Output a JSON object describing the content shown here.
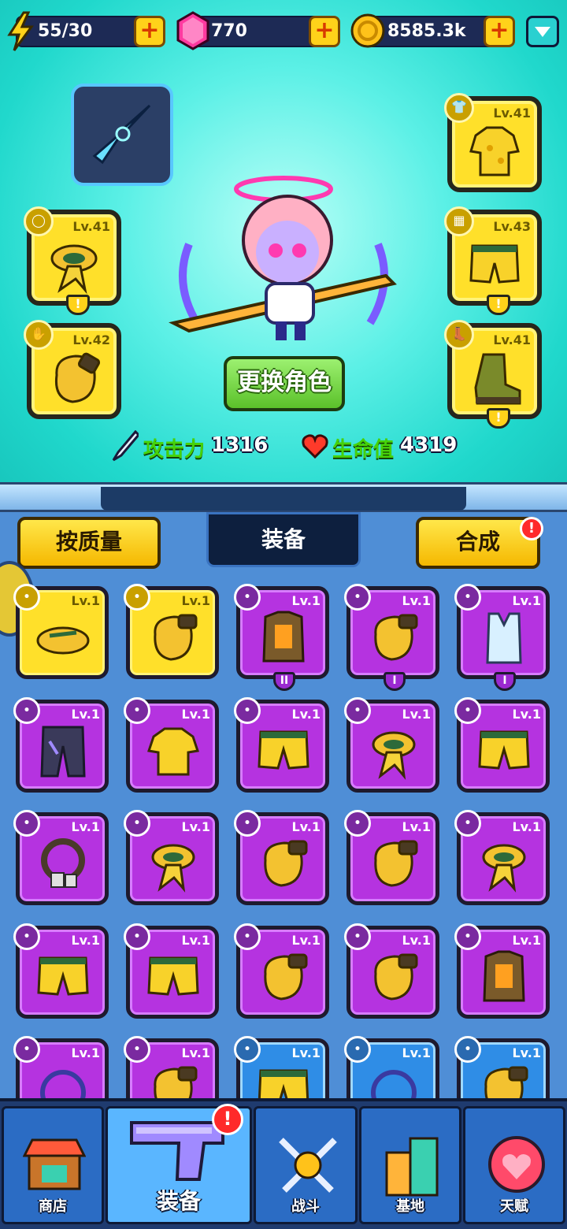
{
  "resources": {
    "energy": "55/30",
    "gems": "770",
    "coins": "8585.3k"
  },
  "equipped": {
    "left": [
      {
        "name": "scarf",
        "level": "Lv.41",
        "has_alert": true
      },
      {
        "name": "glove",
        "level": "Lv.42",
        "has_alert": false
      }
    ],
    "right": [
      {
        "name": "shirt",
        "level": "Lv.41",
        "has_alert": false
      },
      {
        "name": "shorts",
        "level": "Lv.43",
        "has_alert": true
      },
      {
        "name": "boots",
        "level": "Lv.41",
        "has_alert": true
      }
    ]
  },
  "character": {
    "change_button": "更换角色",
    "attack_label": "攻击力",
    "attack_value": "1316",
    "hp_label": "生命值",
    "hp_value": "4319"
  },
  "toolbar": {
    "sort_label": "按质量",
    "tab_label": "装备",
    "merge_label": "合成",
    "merge_badge": "!"
  },
  "inventory_rows": [
    [
      {
        "quality": "y",
        "icon": "sandal-icon",
        "level": "Lv.1",
        "alert": ""
      },
      {
        "quality": "y",
        "icon": "glove-icon",
        "level": "Lv.1",
        "alert": ""
      },
      {
        "quality": "p",
        "icon": "armor-vest-icon",
        "level": "Lv.1",
        "alert": "II"
      },
      {
        "quality": "p",
        "icon": "glove-icon",
        "level": "Lv.1",
        "alert": "I"
      },
      {
        "quality": "p",
        "icon": "tank-top-icon",
        "level": "Lv.1",
        "alert": "I"
      }
    ],
    [
      {
        "quality": "p",
        "icon": "pants-icon",
        "level": "Lv.1",
        "alert": ""
      },
      {
        "quality": "p",
        "icon": "shirt-icon",
        "level": "Lv.1",
        "alert": ""
      },
      {
        "quality": "p",
        "icon": "shorts-icon",
        "level": "Lv.1",
        "alert": ""
      },
      {
        "quality": "p",
        "icon": "scarf-icon",
        "level": "Lv.1",
        "alert": ""
      },
      {
        "quality": "p",
        "icon": "shorts-icon",
        "level": "Lv.1",
        "alert": ""
      }
    ],
    [
      {
        "quality": "p",
        "icon": "necklace-icon",
        "level": "Lv.1",
        "alert": ""
      },
      {
        "quality": "p",
        "icon": "scarf-icon",
        "level": "Lv.1",
        "alert": ""
      },
      {
        "quality": "p",
        "icon": "glove-icon",
        "level": "Lv.1",
        "alert": ""
      },
      {
        "quality": "p",
        "icon": "glove-icon",
        "level": "Lv.1",
        "alert": ""
      },
      {
        "quality": "p",
        "icon": "scarf-icon",
        "level": "Lv.1",
        "alert": ""
      }
    ],
    [
      {
        "quality": "p",
        "icon": "shorts-icon",
        "level": "Lv.1",
        "alert": ""
      },
      {
        "quality": "p",
        "icon": "shorts-icon",
        "level": "Lv.1",
        "alert": ""
      },
      {
        "quality": "p",
        "icon": "glove-icon",
        "level": "Lv.1",
        "alert": ""
      },
      {
        "quality": "p",
        "icon": "glove-icon",
        "level": "Lv.1",
        "alert": ""
      },
      {
        "quality": "p",
        "icon": "armor-vest-icon",
        "level": "Lv.1",
        "alert": ""
      }
    ],
    [
      {
        "quality": "p",
        "icon": "ring-icon",
        "level": "Lv.1",
        "alert": ""
      },
      {
        "quality": "p",
        "icon": "glove-icon",
        "level": "Lv.1",
        "alert": ""
      },
      {
        "quality": "b",
        "icon": "shorts-icon",
        "level": "Lv.1",
        "alert": ""
      },
      {
        "quality": "b",
        "icon": "ring-icon",
        "level": "Lv.1",
        "alert": ""
      },
      {
        "quality": "b",
        "icon": "glove-icon",
        "level": "Lv.1",
        "alert": ""
      }
    ]
  ],
  "nav": {
    "shop": "商店",
    "equipment": "装备",
    "equipment_badge": "!",
    "battle": "战斗",
    "base": "基地",
    "talent": "天赋"
  },
  "colors": {
    "legendary": "#ffe02a",
    "epic": "#b533e0",
    "rare": "#2f8de6",
    "top_bg": "#5cf0e6",
    "panel_bg": "#4f8ed6"
  }
}
